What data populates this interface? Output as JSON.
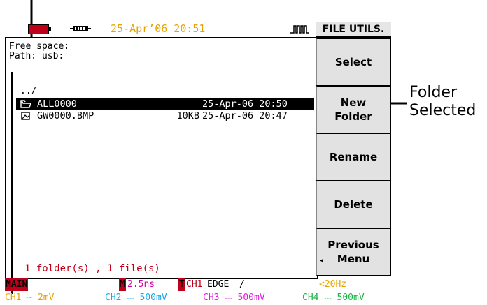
{
  "annotations": {
    "selected_label": [
      "Folder",
      "Selected"
    ]
  },
  "status": {
    "datetime": "25-Apr’06 20:51"
  },
  "panel": {
    "free_space": "Free space:",
    "path": "Path: usb:",
    "parent_dir": "../",
    "files": [
      {
        "name": "ALL0000",
        "size": "",
        "date": "25-Apr-06 20:50",
        "selected": true,
        "icon": "folder-icon"
      },
      {
        "name": "GW0000.BMP",
        "size": "10KB",
        "date": "25-Apr-06 20:47",
        "selected": false,
        "icon": "image-file-icon"
      }
    ],
    "summary": "1 folder(s) , 1 file(s)"
  },
  "menu": {
    "title": "FILE UTILS.",
    "buttons": [
      {
        "line1": "Select",
        "line2": ""
      },
      {
        "line1": "New",
        "line2": "Folder"
      },
      {
        "line1": "Rename",
        "line2": ""
      },
      {
        "line1": "Delete",
        "line2": ""
      },
      {
        "line1": "Previous",
        "line2": "Menu"
      }
    ]
  },
  "bottom": {
    "mode": "MAIN",
    "m_marker": "M",
    "timebase": "2.5ns",
    "t_marker": "T",
    "trigger_src": "CH1",
    "trigger_type": "EDGE",
    "trigger_slope": "/",
    "freq": "<20Hz",
    "channels": [
      {
        "label": "CH1",
        "coupling": "~",
        "value": "2mV",
        "color": "#e6a400"
      },
      {
        "label": "CH2",
        "coupling": "⎓",
        "value": "500mV",
        "color": "#1aa6e6"
      },
      {
        "label": "CH3",
        "coupling": "⎓",
        "value": "500mV",
        "color": "#e01ae0"
      },
      {
        "label": "CH4",
        "coupling": "⎓",
        "value": "500mV",
        "color": "#1ab44a"
      }
    ]
  },
  "colors": {
    "accent_red": "#c0001a",
    "date_amber": "#e6a400",
    "timebase_magenta": "#d000a0"
  }
}
